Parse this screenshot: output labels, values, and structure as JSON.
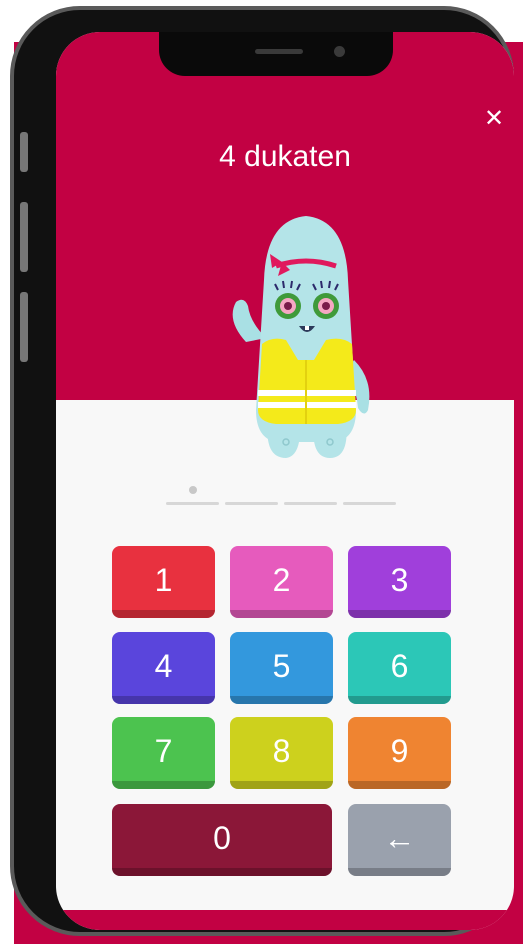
{
  "header": {
    "title": "4 dukaten",
    "close_label": "✕"
  },
  "pin": {
    "length": 4,
    "entered": 1
  },
  "keypad": {
    "keys": [
      {
        "label": "1",
        "color": "#e8313f"
      },
      {
        "label": "2",
        "color": "#e65bbd"
      },
      {
        "label": "3",
        "color": "#a03fdb"
      },
      {
        "label": "4",
        "color": "#5a45dc"
      },
      {
        "label": "5",
        "color": "#3398dd"
      },
      {
        "label": "6",
        "color": "#2cc7b7"
      },
      {
        "label": "7",
        "color": "#4cc34f"
      },
      {
        "label": "8",
        "color": "#cdd11d"
      },
      {
        "label": "9",
        "color": "#ef8431"
      },
      {
        "label": "0",
        "color": "#8b1738"
      },
      {
        "label": "←",
        "color": "#9aa1ad"
      }
    ]
  },
  "colors": {
    "brand": "#c20143",
    "background": "#f8f8f8"
  }
}
